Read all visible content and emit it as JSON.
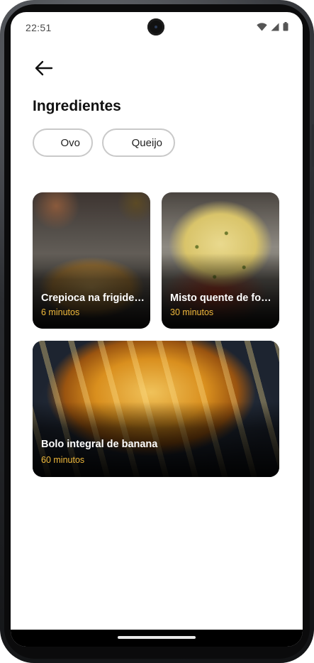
{
  "status_bar": {
    "time": "22:51"
  },
  "page": {
    "heading": "Ingredientes"
  },
  "filters": [
    {
      "label": "Ovo"
    },
    {
      "label": "Queijo"
    }
  ],
  "recipes": [
    {
      "title": "Crepioca na frigideira",
      "time": "6 minutos"
    },
    {
      "title": "Misto quente de forno",
      "time": "30 minutos"
    },
    {
      "title": "Bolo integral de banana",
      "time": "60 minutos"
    }
  ],
  "colors": {
    "accent_time": "#f0b93b",
    "chip_border": "#c9c9c9"
  },
  "icons": {
    "back": "arrow-left-icon",
    "wifi": "wifi-icon",
    "signal": "signal-icon",
    "battery": "battery-icon"
  }
}
